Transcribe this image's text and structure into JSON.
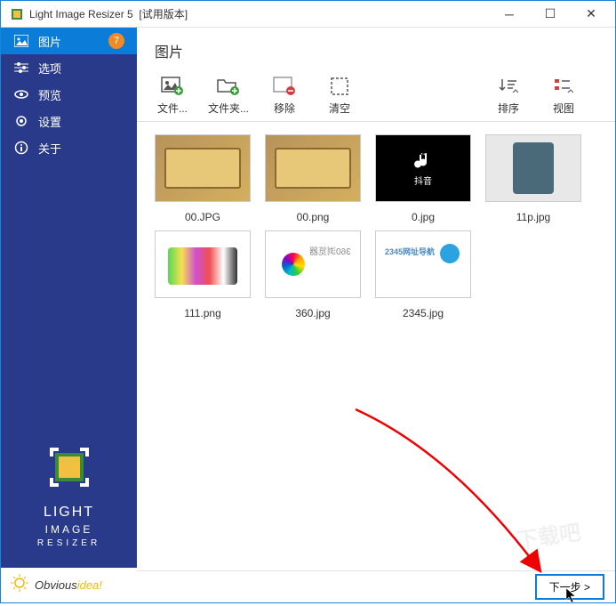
{
  "window": {
    "title": "Light Image Resizer 5",
    "trial": "[试用版本]"
  },
  "sidebar": {
    "items": [
      {
        "label": "图片",
        "badge": "7"
      },
      {
        "label": "选项"
      },
      {
        "label": "预览"
      },
      {
        "label": "设置"
      },
      {
        "label": "关于"
      }
    ],
    "brand1": "LIGHT",
    "brand2": "IMAGE",
    "brand3": "RESIZER"
  },
  "footer": {
    "brand_a": "Obvious",
    "brand_b": "idea",
    "excl": "!"
  },
  "main": {
    "title": "图片",
    "toolbar": {
      "file": "文件...",
      "folder": "文件夹...",
      "remove": "移除",
      "clear": "清空",
      "sort": "排序",
      "view": "视图"
    },
    "thumbs": [
      {
        "name": "00.JPG",
        "style": "gold"
      },
      {
        "name": "00.png",
        "style": "gold"
      },
      {
        "name": "0.jpg",
        "style": "black",
        "caption": "抖音"
      },
      {
        "name": "11p.jpg",
        "style": "phone"
      },
      {
        "name": "111.png",
        "style": "phones"
      },
      {
        "name": "360.jpg",
        "style": "360",
        "caption": "360浏览器"
      },
      {
        "name": "2345.jpg",
        "style": "2345",
        "caption": "2345网址导航"
      }
    ],
    "next": "下一步 >"
  },
  "watermark": "下载吧"
}
